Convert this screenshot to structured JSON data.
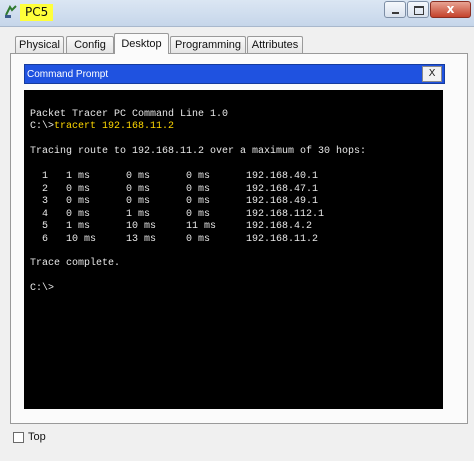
{
  "window": {
    "title": "PC5",
    "icon": "network-device-icon",
    "close_label": "x"
  },
  "tabs": [
    {
      "label": "Physical",
      "active": false
    },
    {
      "label": "Config",
      "active": false
    },
    {
      "label": "Desktop",
      "active": true
    },
    {
      "label": "Programming",
      "active": false
    },
    {
      "label": "Attributes",
      "active": false
    }
  ],
  "command_prompt": {
    "title": "Command Prompt",
    "close_label": "X",
    "lines": {
      "banner": "Packet Tracer PC Command Line 1.0",
      "prompt1": "C:\\>",
      "command": "tracert 192.168.11.2",
      "blank1": "",
      "tracing": "Tracing route to 192.168.11.2 over a maximum of 30 hops:",
      "blank2": "",
      "hop1": "  1   1 ms      0 ms      0 ms      192.168.40.1",
      "hop2": "  2   0 ms      0 ms      0 ms      192.168.47.1",
      "hop3": "  3   0 ms      0 ms      0 ms      192.168.49.1",
      "hop4": "  4   0 ms      1 ms      0 ms      192.168.112.1",
      "hop5": "  5   1 ms      10 ms     11 ms     192.168.4.2",
      "hop6": "  6   10 ms     13 ms     0 ms      192.168.11.2",
      "blank3": "",
      "complete": "Trace complete.",
      "blank4": "",
      "prompt2": "C:\\>"
    }
  },
  "footer": {
    "top_checkbox_label": "Top",
    "top_checked": false
  },
  "colors": {
    "title_highlight": "#ffff3a",
    "cp_header": "#1f52e0",
    "terminal_bg": "#000000",
    "terminal_text": "#e8e8e8",
    "command_text": "#ffd800"
  }
}
